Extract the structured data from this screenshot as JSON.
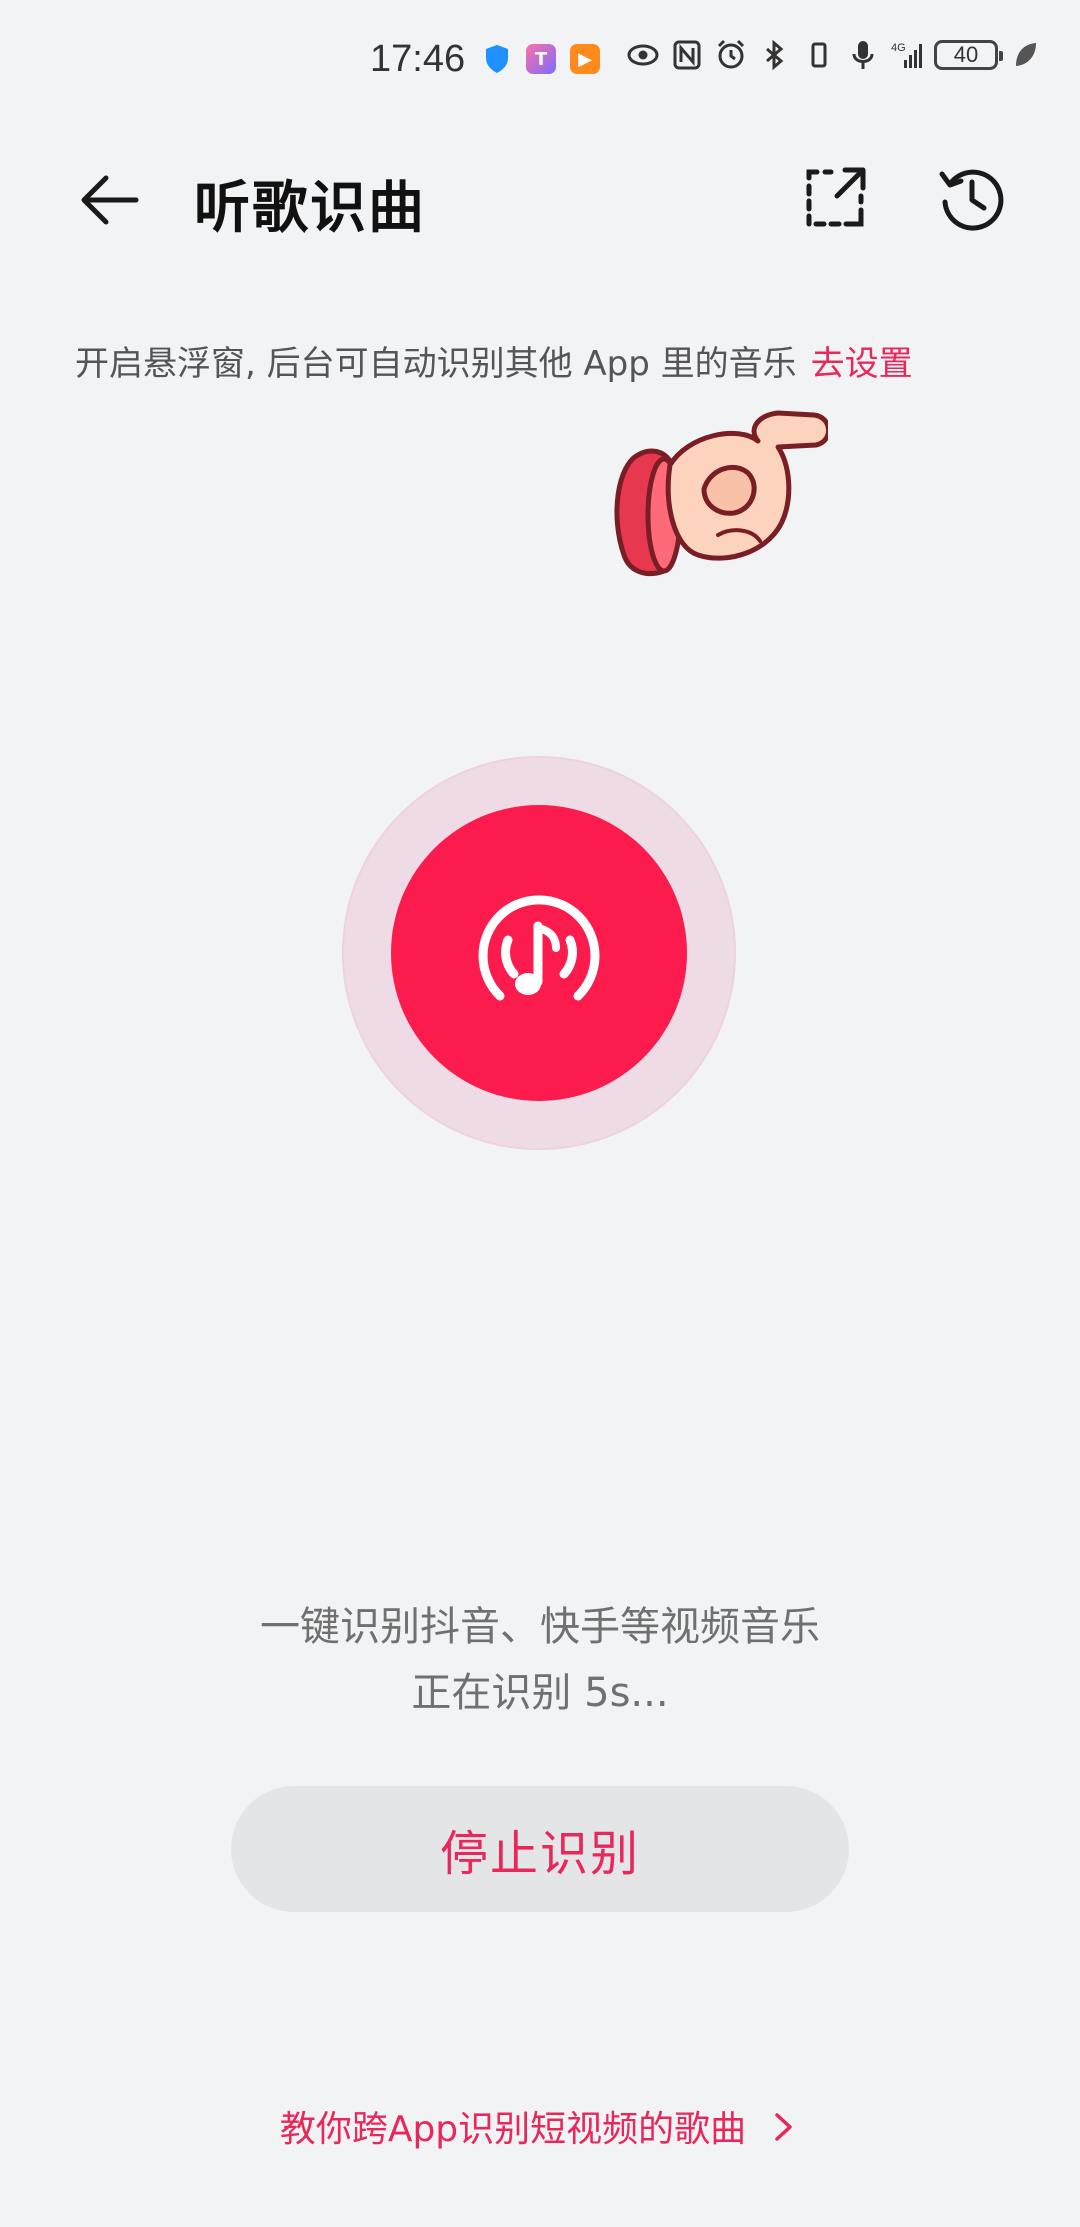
{
  "status_bar": {
    "time": "17:46",
    "battery": "40"
  },
  "header": {
    "title": "听歌识曲"
  },
  "hint": {
    "text": "开启悬浮窗, 后台可自动识别其他 App 里的音乐",
    "link": "去设置"
  },
  "recognition": {
    "description": "一键识别抖音、快手等视频音乐",
    "progress": "正在识别 5s..."
  },
  "stop_button": {
    "label": "停止识别"
  },
  "footer": {
    "tutorial_link": "教你跨App识别短视频的歌曲"
  },
  "colors": {
    "accent": "#e8285b",
    "record_button": "#fb1b4c",
    "ring": "#efdbe6",
    "background": "#f1f3f5"
  },
  "icons": {
    "back": "arrow-left-icon",
    "float_window": "float-window-icon",
    "history": "history-icon",
    "record": "music-wave-icon",
    "chevron": "chevron-right-icon"
  }
}
